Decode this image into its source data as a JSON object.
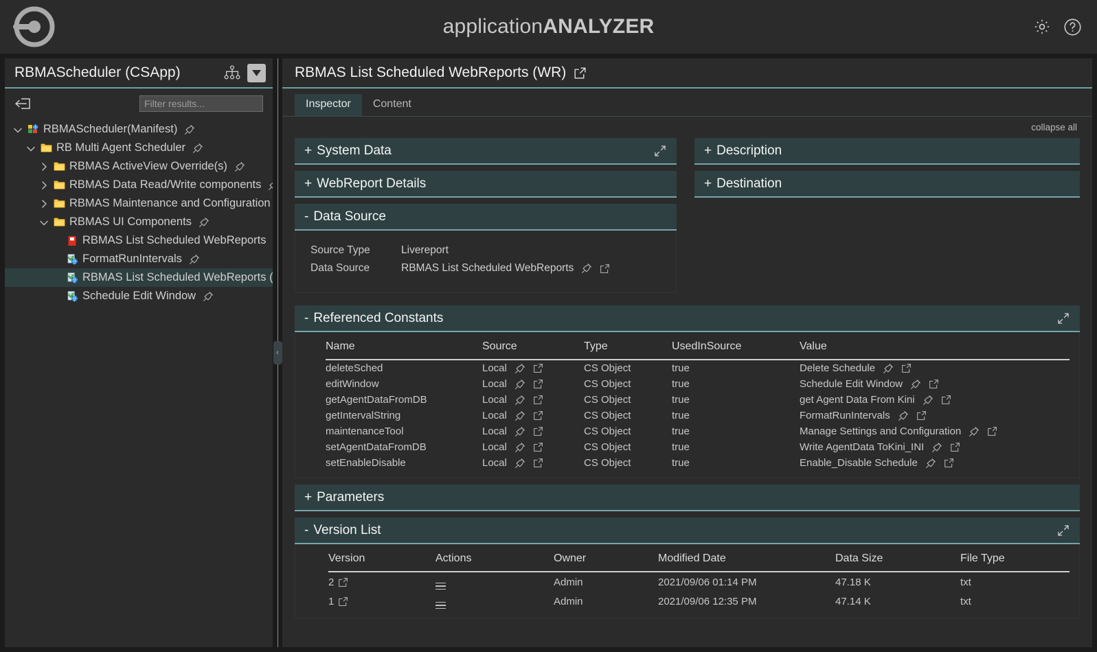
{
  "app": {
    "brand_light": "application",
    "brand_bold": "ANALYZER",
    "logo_icon": "circle-target-logo",
    "settings_icon": "gear-icon",
    "help_icon": "question-circle-icon"
  },
  "sidebar": {
    "title": "RBMAScheduler (CSApp)",
    "hierarchy_icon": "hierarchy-icon",
    "dropdown_icon": "chevron-down-icon",
    "collapse_icon": "collapse-panel-icon",
    "filter_placeholder": "Filter results...",
    "filter_value": "",
    "tree": [
      {
        "label": "RBMAScheduler(Manifest)",
        "depth": 0,
        "twisty": "down",
        "icon": "manifest-icon",
        "pin": true,
        "selected": false
      },
      {
        "label": "RB Multi Agent Scheduler",
        "depth": 1,
        "twisty": "down",
        "icon": "folder-icon",
        "pin": true,
        "selected": false
      },
      {
        "label": "RBMAS ActiveView Override(s)",
        "depth": 2,
        "twisty": "right",
        "icon": "folder-icon",
        "pin": true,
        "selected": false
      },
      {
        "label": "RBMAS Data Read/Write components",
        "depth": 2,
        "twisty": "right",
        "icon": "folder-icon",
        "pin": true,
        "selected": false
      },
      {
        "label": "RBMAS Maintenance and Configuration",
        "depth": 2,
        "twisty": "right",
        "icon": "folder-icon",
        "pin": true,
        "selected": false
      },
      {
        "label": "RBMAS UI Components",
        "depth": 2,
        "twisty": "down",
        "icon": "folder-icon",
        "pin": true,
        "selected": false
      },
      {
        "label": "RBMAS List Scheduled WebReports",
        "depth": 3,
        "twisty": "none",
        "icon": "red-report-icon",
        "pin": true,
        "selected": false
      },
      {
        "label": "FormatRunIntervals",
        "depth": 3,
        "twisty": "none",
        "icon": "webreport-icon",
        "pin": true,
        "selected": false
      },
      {
        "label": "RBMAS List Scheduled WebReports (WR)",
        "depth": 3,
        "twisty": "none",
        "icon": "webreport-icon",
        "pin": true,
        "selected": true
      },
      {
        "label": "Schedule Edit Window",
        "depth": 3,
        "twisty": "none",
        "icon": "webreport-icon",
        "pin": true,
        "selected": false
      }
    ]
  },
  "splitter": {
    "handle_glyph": "‹"
  },
  "main": {
    "title": "RBMAS List Scheduled WebReports (WR)",
    "title_external_icon": "external-link-icon",
    "tabs": [
      {
        "label": "Inspector",
        "active": true
      },
      {
        "label": "Content",
        "active": false
      }
    ],
    "collapse_all": "collapse all",
    "panels": {
      "system_data": {
        "sign": "+",
        "title": "System Data",
        "expandable": true
      },
      "webreport_details": {
        "sign": "+",
        "title": "WebReport Details",
        "expandable": false
      },
      "data_source": {
        "sign": "-",
        "title": "Data Source",
        "expandable": false
      },
      "description": {
        "sign": "+",
        "title": "Description",
        "expandable": false
      },
      "destination": {
        "sign": "+",
        "title": "Destination",
        "expandable": false
      },
      "referenced_constants": {
        "sign": "-",
        "title": "Referenced Constants",
        "expandable": true
      },
      "parameters": {
        "sign": "+",
        "title": "Parameters",
        "expandable": false
      },
      "version_list": {
        "sign": "-",
        "title": "Version List",
        "expandable": true
      }
    },
    "data_source": {
      "rows": [
        {
          "key": "Source Type",
          "value": "Livereport",
          "pin": false,
          "ext": false
        },
        {
          "key": "Data Source",
          "value": "RBMAS List Scheduled WebReports",
          "pin": true,
          "ext": true
        }
      ]
    },
    "referenced_constants": {
      "columns": [
        "Name",
        "Source",
        "Type",
        "UsedInSource",
        "Value"
      ],
      "rows": [
        {
          "name": "deleteSched",
          "source": "Local",
          "type": "CS Object",
          "used": "true",
          "value": "Delete Schedule"
        },
        {
          "name": "editWindow",
          "source": "Local",
          "type": "CS Object",
          "used": "true",
          "value": "Schedule Edit Window"
        },
        {
          "name": "getAgentDataFromDB",
          "source": "Local",
          "type": "CS Object",
          "used": "true",
          "value": "get Agent Data From Kini"
        },
        {
          "name": "getIntervalString",
          "source": "Local",
          "type": "CS Object",
          "used": "true",
          "value": "FormatRunIntervals"
        },
        {
          "name": "maintenanceTool",
          "source": "Local",
          "type": "CS Object",
          "used": "true",
          "value": "Manage Settings and Configuration"
        },
        {
          "name": "setAgentDataFromDB",
          "source": "Local",
          "type": "CS Object",
          "used": "true",
          "value": "Write AgentData ToKini_INI"
        },
        {
          "name": "setEnableDisable",
          "source": "Local",
          "type": "CS Object",
          "used": "true",
          "value": "Enable_Disable Schedule"
        }
      ]
    },
    "version_list": {
      "columns": [
        "Version",
        "Actions",
        "Owner",
        "Modified Date",
        "Data Size",
        "File Type"
      ],
      "rows": [
        {
          "version": "2",
          "actions_icon": "hamburger-menu-icon",
          "owner": "Admin",
          "modified": "2021/09/06 01:14 PM",
          "size": "47.18 K",
          "filetype": "txt"
        },
        {
          "version": "1",
          "actions_icon": "hamburger-menu-icon",
          "owner": "Admin",
          "modified": "2021/09/06 12:35 PM",
          "size": "47.14 K",
          "filetype": "txt"
        }
      ]
    }
  },
  "colors": {
    "accent_teal": "#77a5aa",
    "panel_header": "#2e4042",
    "app_bg": "#1b1b1b",
    "surface": "#2b2b2b",
    "selected_row": "#2e3f40",
    "text": "#cfcfcf"
  }
}
